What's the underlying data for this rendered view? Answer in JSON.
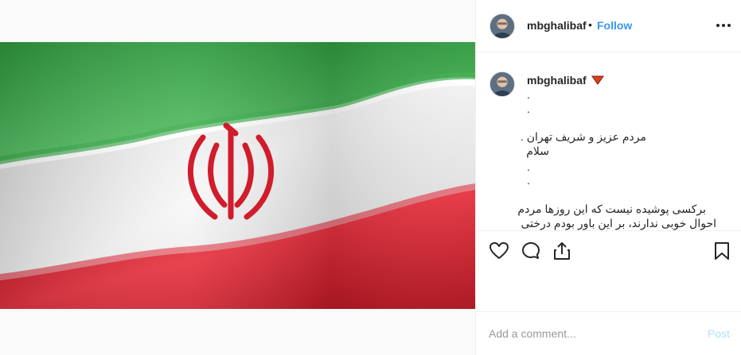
{
  "post": {
    "image_icon": "iran-flag-image"
  },
  "header": {
    "username": "mbghalibaf",
    "separator": "•",
    "follow_label": "Follow",
    "more_icon": "more-options-icon"
  },
  "caption": {
    "username": "mbghalibaf",
    "badge_icon": "red-triangle-icon",
    "lines": [
      ".",
      ".",
      "مردم عزیز و شریف تهران .",
      "سلام",
      ".",
      ".",
      "برکسی پوشیده نیست که این روزها مردم",
      "احوال خوبی ندارند، بر این باور بودم درختی"
    ]
  },
  "actions": {
    "like_icon": "heart-icon",
    "comment_icon": "comment-icon",
    "share_icon": "share-icon",
    "save_icon": "bookmark-icon"
  },
  "comment_bar": {
    "placeholder": "Add a comment...",
    "post_label": "Post"
  },
  "colors": {
    "link_blue": "#3897f0",
    "post_disabled": "#b2dffc",
    "flag_green": "#3aa94a",
    "flag_white": "#f2f2f2",
    "flag_red": "#d9202e"
  }
}
